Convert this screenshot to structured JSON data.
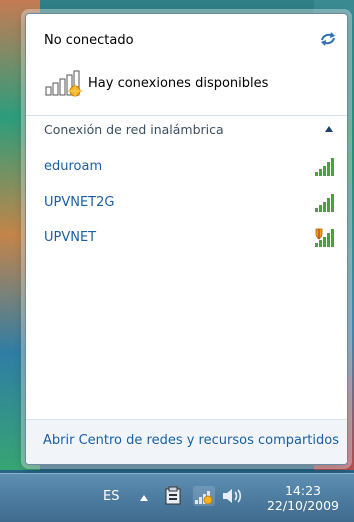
{
  "flyout": {
    "status_title": "No conectado",
    "available_text": "Hay conexiones disponibles",
    "section_title": "Conexión de red inalámbrica",
    "networks": [
      {
        "name": "eduroam"
      },
      {
        "name": "UPVNET2G"
      },
      {
        "name": "UPVNET"
      }
    ],
    "footer_link": "Abrir Centro de redes y recursos compartidos"
  },
  "taskbar": {
    "language": "ES",
    "time": "14:23",
    "date": "22/10/2009"
  },
  "icons": {
    "refresh": "refresh-icon",
    "signal": "wifi-signal-icon",
    "secured": "shield-icon",
    "collapse": "chevron-up-icon"
  }
}
